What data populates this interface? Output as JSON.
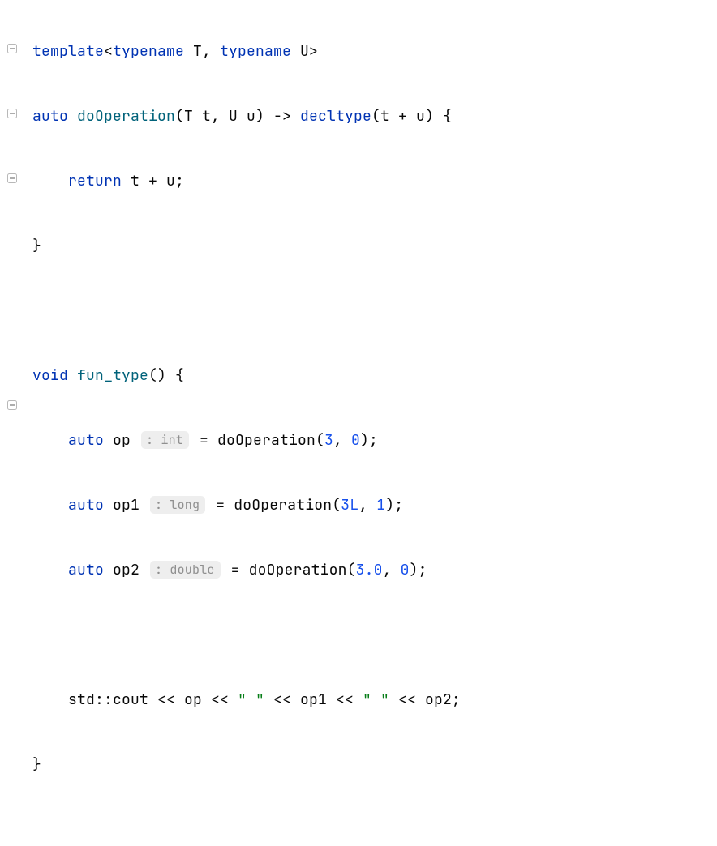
{
  "code": {
    "line1": {
      "kw_template": "template",
      "lt": "<",
      "kw_typename1": "typename",
      "t1": " T",
      "comma": ", ",
      "kw_typename2": "typename",
      "t2": " U",
      "gt": ">"
    },
    "line2": {
      "kw_auto": "auto",
      "sp1": " ",
      "fn_name": "doOperation",
      "params": "(T t, U u) -> ",
      "kw_decltype": "decltype",
      "after": "(t + u) {"
    },
    "line3": {
      "indent": "    ",
      "kw_return": "return",
      "expr": " t + u;"
    },
    "line4": {
      "brace": "}"
    },
    "line5": {
      "empty": ""
    },
    "line6": {
      "kw_void": "void",
      "sp": " ",
      "fn_name": "fun_type",
      "after": "() {"
    },
    "line7": {
      "indent": "    ",
      "kw_auto": "auto",
      "var": " op ",
      "hint": ": int",
      "eq": " = ",
      "call": "doOperation(",
      "arg1": "3",
      "c1": ", ",
      "arg2": "0",
      "close": ");"
    },
    "line8": {
      "indent": "    ",
      "kw_auto": "auto",
      "var": " op1 ",
      "hint": ": long",
      "eq": " = ",
      "call": "doOperation(",
      "arg1": "3L",
      "c1": ", ",
      "arg2": "1",
      "close": ");"
    },
    "line9": {
      "indent": "    ",
      "kw_auto": "auto",
      "var": " op2 ",
      "hint": ": double",
      "eq": " = ",
      "call": "doOperation(",
      "arg1": "3.0",
      "c1": ", ",
      "arg2": "0",
      "close": ");"
    },
    "line10": {
      "empty": ""
    },
    "line11": {
      "indent": "    ",
      "txt1": "std::cout << op << ",
      "str1": "\" \"",
      "txt2": " << op1 << ",
      "str2": "\" \"",
      "txt3": " << op2;"
    },
    "line12": {
      "brace": "}"
    }
  },
  "icons": {
    "fold_open": "fold-expanded-icon",
    "fold_close": "fold-collapse-icon"
  }
}
